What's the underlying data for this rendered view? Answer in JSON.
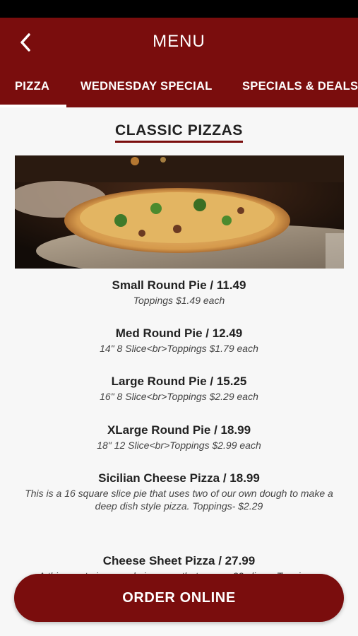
{
  "header": {
    "title": "MENU",
    "back_icon": "chevron-left-icon"
  },
  "tabs": [
    {
      "label": "PIZZA",
      "active": true
    },
    {
      "label": "WEDNESDAY SPECIAL",
      "active": false
    },
    {
      "label": "SPECIALS & DEALS",
      "active": false
    }
  ],
  "section": {
    "title": "CLASSIC PIZZAS"
  },
  "items": [
    {
      "title": "Small Round Pie / 11.49",
      "desc": "Toppings $1.49 each"
    },
    {
      "title": "Med Round Pie / 12.49",
      "desc": "14\" 8 Slice<br>Toppings $1.79 each"
    },
    {
      "title": "Large Round Pie / 15.25",
      "desc": "16\" 8 Slice<br>Toppings $2.29 each"
    },
    {
      "title": "XLarge Round Pie / 18.99",
      "desc": "18\" 12 Slice<br>Toppings $2.99 each"
    },
    {
      "title": "Sicilian Cheese Pizza / 18.99",
      "desc": "This is a 16 square slice pie that uses two of our own dough to make a deep dish style pizza. Toppings- $2.29"
    },
    {
      "title": "Cheese Sheet Pizza / 27.99",
      "desc": "A thin crust pizza made in a pan that serves 32 slices. Toppings-"
    }
  ],
  "order_button": {
    "label": "ORDER ONLINE"
  },
  "colors": {
    "brand": "#7a0d0d",
    "background": "#f7f7f7"
  }
}
